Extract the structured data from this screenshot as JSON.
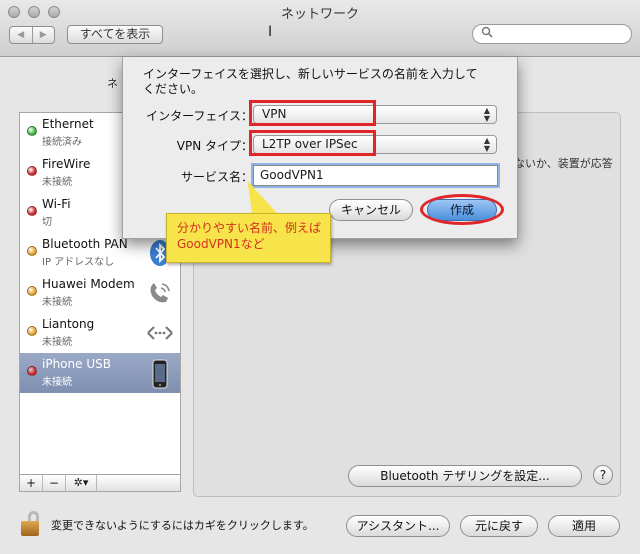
{
  "window": {
    "title": "ネットワーク",
    "show_all_label": "すべてを表示",
    "nav_back": "◀",
    "nav_forward": "▶"
  },
  "services": [
    {
      "name": "Ethernet",
      "status": "接続済み",
      "status_color": "#3cb43c",
      "icon": "none"
    },
    {
      "name": "FireWire",
      "status": "未接続",
      "status_color": "#d22828",
      "icon": "firewire-icon"
    },
    {
      "name": "Wi-Fi",
      "status": "切",
      "status_color": "#d22828",
      "icon": "wifi-icon"
    },
    {
      "name": "Bluetooth PAN",
      "status": "IP アドレスなし",
      "status_color": "#e6a028",
      "icon": "bluetooth-icon"
    },
    {
      "name": "Huawei Modem",
      "status": "未接続",
      "status_color": "#e6a028",
      "icon": "phone-modem-icon"
    },
    {
      "name": "Liantong",
      "status": "未接続",
      "status_color": "#e6a028",
      "icon": "vpn-arrows-icon"
    },
    {
      "name": "iPhone USB",
      "status": "未接続",
      "status_color": "#d22828",
      "icon": "iphone-icon",
      "selected": true
    }
  ],
  "sidebar_toolbar": {
    "add": "+",
    "remove": "−",
    "gear": "✲▾"
  },
  "background": {
    "partial_left": "ネ",
    "partial_right": "ないか、装置が応答"
  },
  "dialog": {
    "prompt": "インターフェイスを選択し、新しいサービスの名前を入力して\nください。",
    "interface_label": "インターフェイス：",
    "interface_value": "VPN",
    "vpn_type_label": "VPN タイプ：",
    "vpn_type_value": "L2TP over IPSec",
    "service_name_label": "サービス名：",
    "service_name_value": "GoodVPN1",
    "cancel_label": "キャンセル",
    "create_label": "作成"
  },
  "callout": {
    "text": "分かりやすい名前、例えばGoodVPN1など"
  },
  "bottom": {
    "bluetooth_tethering_label": "Bluetooth テザリングを設定...",
    "help_label": "?",
    "lock_text": "変更できないようにするにはカギをクリックします。",
    "assistant_label": "アシスタント...",
    "revert_label": "元に戻す",
    "apply_label": "適用"
  },
  "colors": {
    "highlight_red": "#e0262a",
    "callout_yellow": "#f7e34a",
    "callout_text": "#d1321e",
    "selection_blue": "#8b9bbd"
  }
}
